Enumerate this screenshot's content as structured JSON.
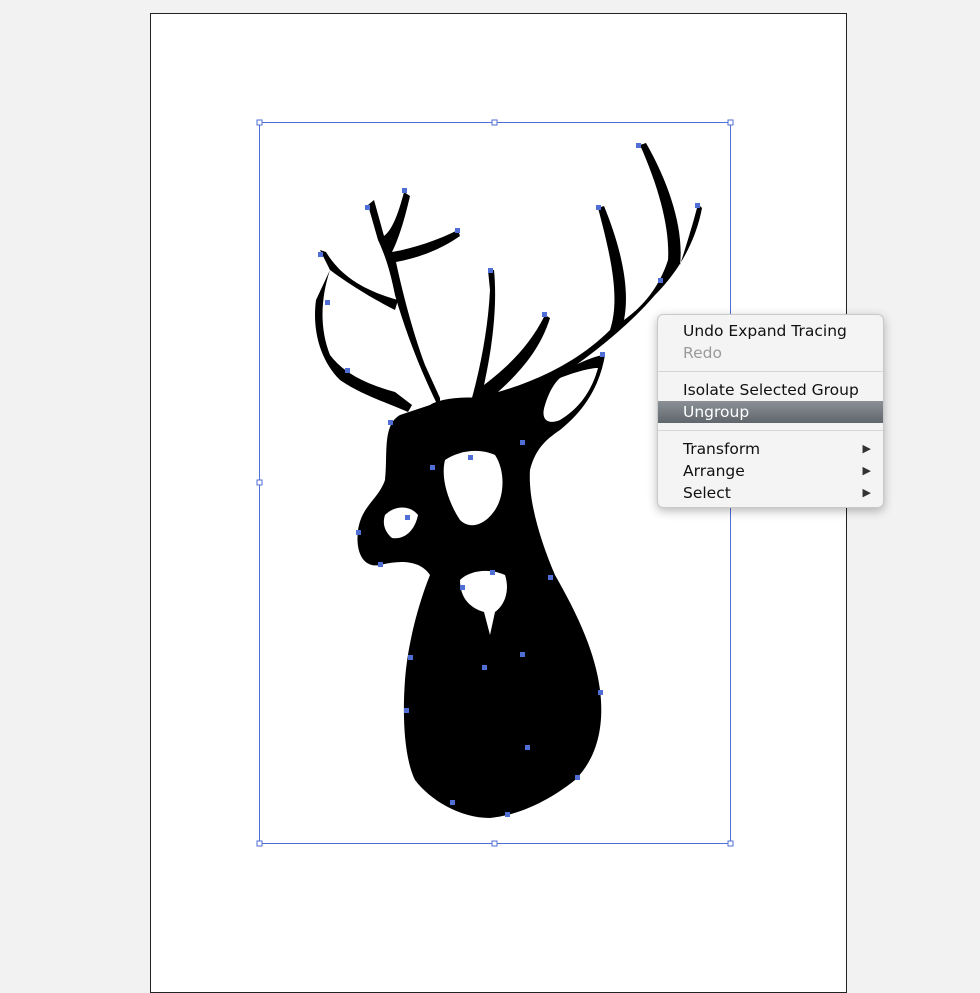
{
  "context_menu": {
    "items": [
      {
        "label": "Undo Expand Tracing",
        "enabled": true
      },
      {
        "label": "Redo",
        "enabled": false
      },
      {
        "label": "Isolate Selected Group",
        "enabled": true
      },
      {
        "label": "Ungroup",
        "enabled": true,
        "highlighted": true
      },
      {
        "label": "Transform",
        "enabled": true,
        "submenu": true
      },
      {
        "label": "Arrange",
        "enabled": true,
        "submenu": true
      },
      {
        "label": "Select",
        "enabled": true,
        "submenu": true
      }
    ],
    "submenu_icon": "triangle-right-icon"
  },
  "artwork": {
    "subject": "stag-head-silhouette",
    "fill_color": "#000000",
    "selection_color": "#4f6fd6",
    "selected": true
  }
}
